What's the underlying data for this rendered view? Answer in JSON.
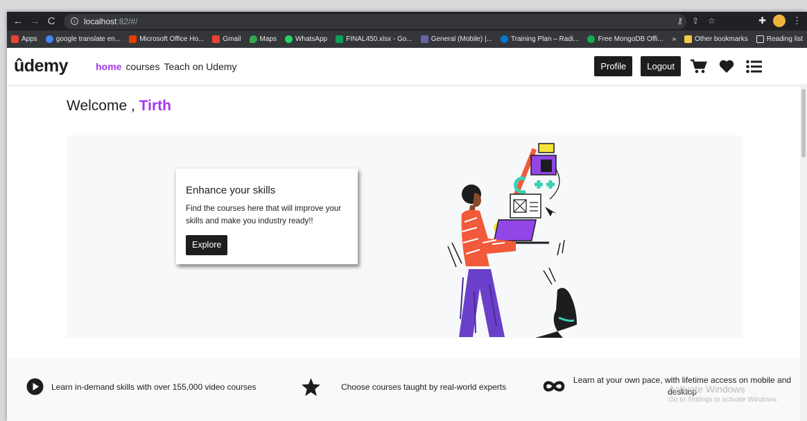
{
  "browser": {
    "url_host": "localhost",
    "url_path": ":82/#/",
    "bookmarks": [
      {
        "label": "Apps",
        "color": "#ea4335"
      },
      {
        "label": "google translate en...",
        "color": "#4285f4"
      },
      {
        "label": "Microsoft Office Ho...",
        "color": "#eb3c00"
      },
      {
        "label": "Gmail",
        "color": "#ea4335"
      },
      {
        "label": "Maps",
        "color": "#34a853"
      },
      {
        "label": "WhatsApp",
        "color": "#25d366"
      },
      {
        "label": "FINAL450.xlsx - Go...",
        "color": "#0f9d58"
      },
      {
        "label": "General (Mobile) |...",
        "color": "#6264a7"
      },
      {
        "label": "Training Plan – Radi...",
        "color": "#0078d4"
      },
      {
        "label": "Free MongoDB Offi...",
        "color": "#13aa52"
      }
    ],
    "more": "»",
    "other_bookmarks": "Other bookmarks",
    "reading_list": "Reading list"
  },
  "navbar": {
    "logo": "ûdemy",
    "links": [
      "home",
      "courses",
      "Teach on Udemy"
    ],
    "profile": "Profile",
    "logout": "Logout"
  },
  "welcome": {
    "prefix": "Welcome ,",
    "user": "Tirth"
  },
  "hero": {
    "title": "Enhance your skills",
    "text": "Find the courses here that will improve your skills and make you industry ready!!",
    "button": "Explore"
  },
  "features": [
    {
      "icon": "play-circle-icon",
      "text": "Learn in-demand skills with over 155,000 video courses"
    },
    {
      "icon": "star-icon",
      "text": "Choose courses taught by real-world experts"
    },
    {
      "icon": "infinity-icon",
      "text": "Learn at your own pace, with lifetime access on mobile and desktop"
    }
  ],
  "watermark": {
    "title": "Activate Windows",
    "sub": "Go to Settings to activate Windows."
  },
  "colors": {
    "accent": "#a435f0",
    "dark": "#1c1d1f"
  }
}
